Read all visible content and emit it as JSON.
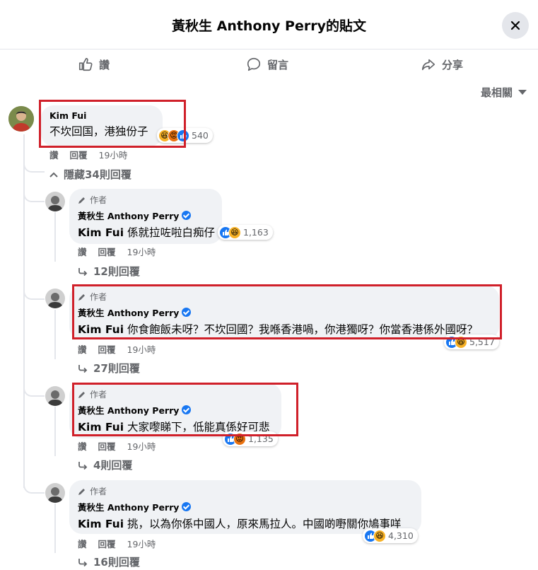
{
  "header": {
    "title": "黃秋生 Anthony Perry的貼文"
  },
  "actions": {
    "like": "讚",
    "comment": "留言",
    "share": "分享"
  },
  "sort": {
    "label": "最相關"
  },
  "colors": {
    "accent": "#1877f2",
    "highlight": "#d0202a",
    "muted": "#65676b"
  },
  "top_comment": {
    "author": "Kim Fui",
    "text": "不坎回国，港独份子",
    "reactions": [
      "haha",
      "angry",
      "like"
    ],
    "count": "540",
    "like": "讚",
    "reply": "回覆",
    "time": "19小時",
    "hide_replies": "隱藏34則回覆"
  },
  "replies": [
    {
      "tag": "作者",
      "author": "黃秋生 Anthony Perry",
      "mention": "Kim Fui",
      "text": "係就拉咗啦白痴仔",
      "reactions": [
        "like",
        "haha"
      ],
      "count": "1,163",
      "like": "讚",
      "reply": "回覆",
      "time": "19小時",
      "more": "12則回覆"
    },
    {
      "tag": "作者",
      "author": "黃秋生 Anthony Perry",
      "mention": "Kim Fui",
      "text": "你食飽飯未呀？不坎回國？我喺香港喎，你港獨呀？你當香港係外國呀？",
      "reactions": [
        "like",
        "haha"
      ],
      "count": "5,517",
      "like": "讚",
      "reply": "回覆",
      "time": "19小時",
      "more": "27則回覆"
    },
    {
      "tag": "作者",
      "author": "黃秋生 Anthony Perry",
      "mention": "Kim Fui",
      "text": "大家嚟睇下，低能真係好可悲",
      "reactions": [
        "like",
        "angry"
      ],
      "count": "1,135",
      "like": "讚",
      "reply": "回覆",
      "time": "19小時",
      "more": "4則回覆"
    },
    {
      "tag": "作者",
      "author": "黃秋生 Anthony Perry",
      "mention": "Kim Fui",
      "text": "挑，以為你係中國人，原來馬拉人。中國啲嘢關你鳩事咩",
      "reactions": [
        "like",
        "haha"
      ],
      "count": "4,310",
      "like": "讚",
      "reply": "回覆",
      "time": "19小時",
      "more": "16則回覆"
    }
  ]
}
